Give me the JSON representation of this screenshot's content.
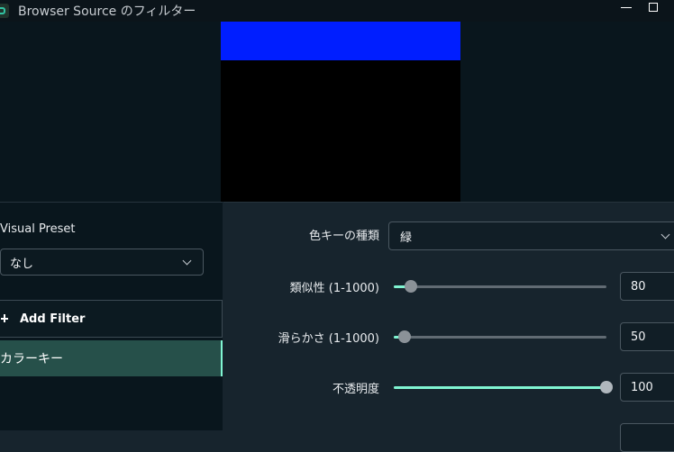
{
  "window": {
    "title": "Browser Source のフィルター",
    "icon": "obs-app-icon"
  },
  "colors": {
    "accent": "#80f5d2",
    "selected_filter_bg": "#26504a",
    "preview_blue": "#001eff"
  },
  "left_panel": {
    "preset_label": "Visual Preset",
    "preset_value": "なし",
    "add_filter_label": "Add Filter",
    "filters": [
      {
        "label": "カラーキー",
        "selected": true
      }
    ]
  },
  "settings": {
    "key_color_type": {
      "label": "色キーの種類",
      "value": "緑"
    },
    "similarity": {
      "label": "類似性 (1-1000)",
      "value": "80",
      "min": 1,
      "max": 1000
    },
    "smoothness": {
      "label": "滑らかさ (1-1000)",
      "value": "50",
      "min": 1,
      "max": 1000
    },
    "opacity": {
      "label": "不透明度",
      "value": "100",
      "min": 0,
      "max": 100
    }
  }
}
